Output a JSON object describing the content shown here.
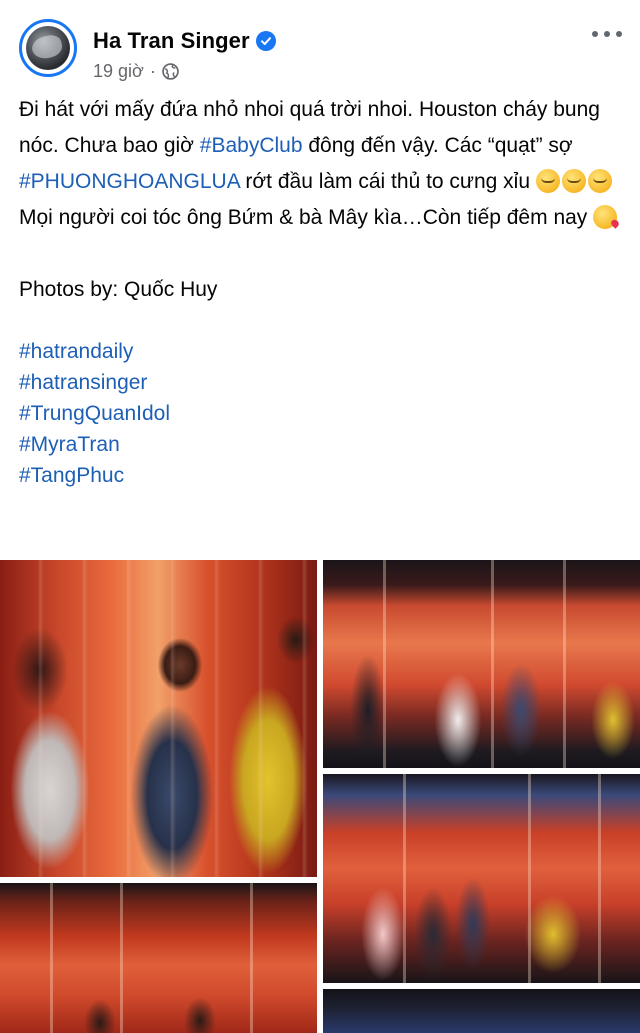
{
  "post": {
    "author": "Ha Tran Singer",
    "verified_icon": "verified-badge-icon",
    "time": "19 giờ",
    "separator": "·",
    "audience_icon": "globe-icon",
    "more_icon": "more-options-icon",
    "text": {
      "line1_a": "Đi hát với mấy đứa nhỏ nhoi quá trời nhoi. Houston cháy bung nóc. Chưa bao giờ ",
      "hashtag1": "#BabyClub",
      "line1_b": " đông đến vậy. Các “quạt” sợ ",
      "hashtag2": "#PHUONGHOANGLUA",
      "line1_c": " rớt đầu làm cái thủ to cưng xỉu",
      "line2": "Mọi người coi tóc ông Bứm & bà Mây kìa…Còn tiếp đêm nay",
      "credit": "Photos by: Quốc Huy"
    },
    "hashtags": [
      "#hatrandaily",
      "#hatransinger",
      "#TrungQuanIdol",
      "#MyraTran",
      "#TangPhuc"
    ],
    "emoji": [
      "melting-face-emoji",
      "melting-face-emoji",
      "melting-face-emoji",
      "face-blowing-kiss-emoji"
    ],
    "photos": [
      "concert-photo-1",
      "concert-photo-2",
      "concert-photo-3",
      "concert-photo-4",
      "concert-photo-5"
    ],
    "colors": {
      "link": "#1d5fb6",
      "verified": "#1877f2",
      "meta": "#65676b",
      "text": "#050505"
    }
  }
}
